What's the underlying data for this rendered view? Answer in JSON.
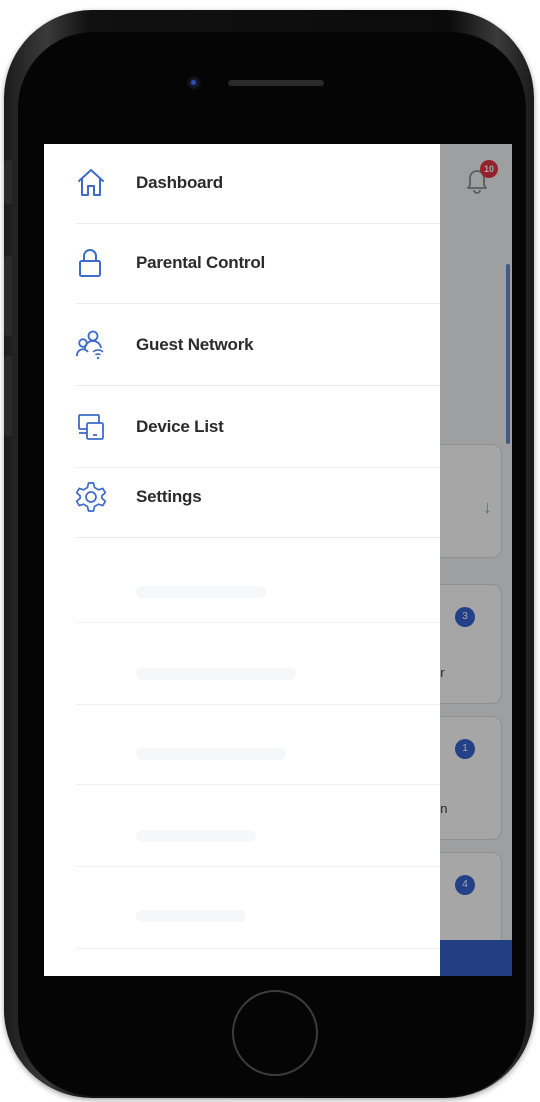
{
  "notifications": {
    "count": "10"
  },
  "drawer": {
    "items": [
      {
        "label": "Dashboard",
        "icon": "home-icon"
      },
      {
        "label": "Parental Control",
        "icon": "lock-icon"
      },
      {
        "label": "Guest Network",
        "icon": "guest-network-icon"
      },
      {
        "label": "Device List",
        "icon": "device-list-icon"
      },
      {
        "label": "Settings",
        "icon": "gear-icon"
      }
    ]
  },
  "background": {
    "cards": [
      {
        "badge": ""
      },
      {
        "badge": "3",
        "fragment": "er"
      },
      {
        "badge": "1",
        "fragment": "on"
      },
      {
        "badge": "4"
      }
    ]
  },
  "colors": {
    "accent": "#3e6bc8",
    "badge": "#e02a3d",
    "text": "#2b2b2b"
  }
}
